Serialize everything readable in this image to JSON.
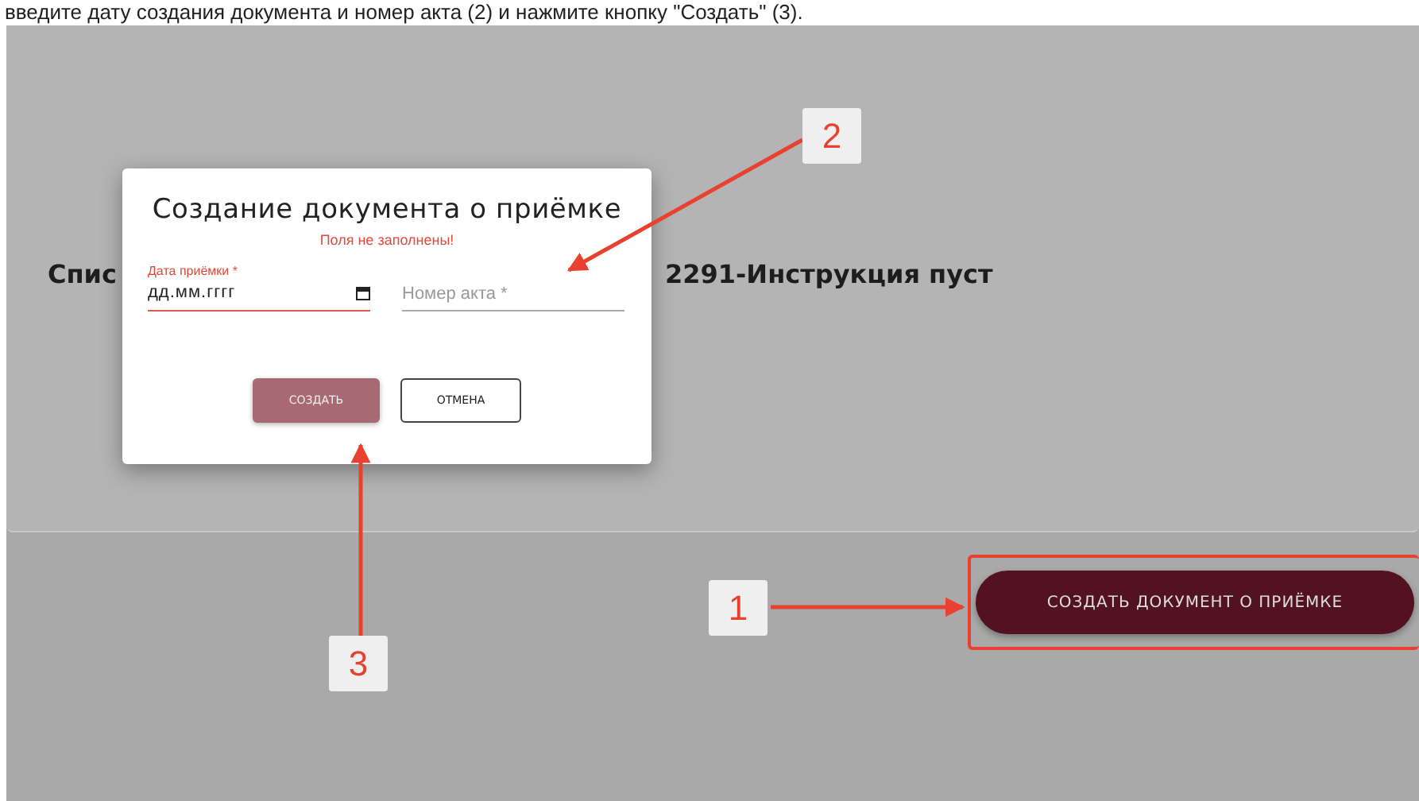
{
  "instruction": "введите дату создания документа и номер акта (2) и нажмите кнопку \"Создать\" (3).",
  "page": {
    "heading_parts": [
      "Спис",
      "2291-Инструкция пуст"
    ],
    "create_button": {
      "label": "СОЗДАТЬ ДОКУМЕНТ О ПРИЁМКЕ",
      "highlighted": true
    }
  },
  "dialog": {
    "title": "Создание документа о приёмке",
    "error": "Поля не заполнены!",
    "fields": [
      {
        "kind": "date",
        "label": "Дата приёмки *",
        "value": "дд.мм.гггг",
        "invalid": true
      },
      {
        "kind": "text",
        "placeholder": "Номер акта *",
        "invalid": false
      }
    ],
    "buttons": [
      {
        "kind": "primary",
        "label": "СОЗДАТЬ"
      },
      {
        "kind": "outline",
        "label": "ОТМЕНА"
      }
    ]
  },
  "annotations": [
    {
      "label": "1"
    },
    {
      "label": "2"
    },
    {
      "label": "3"
    }
  ]
}
